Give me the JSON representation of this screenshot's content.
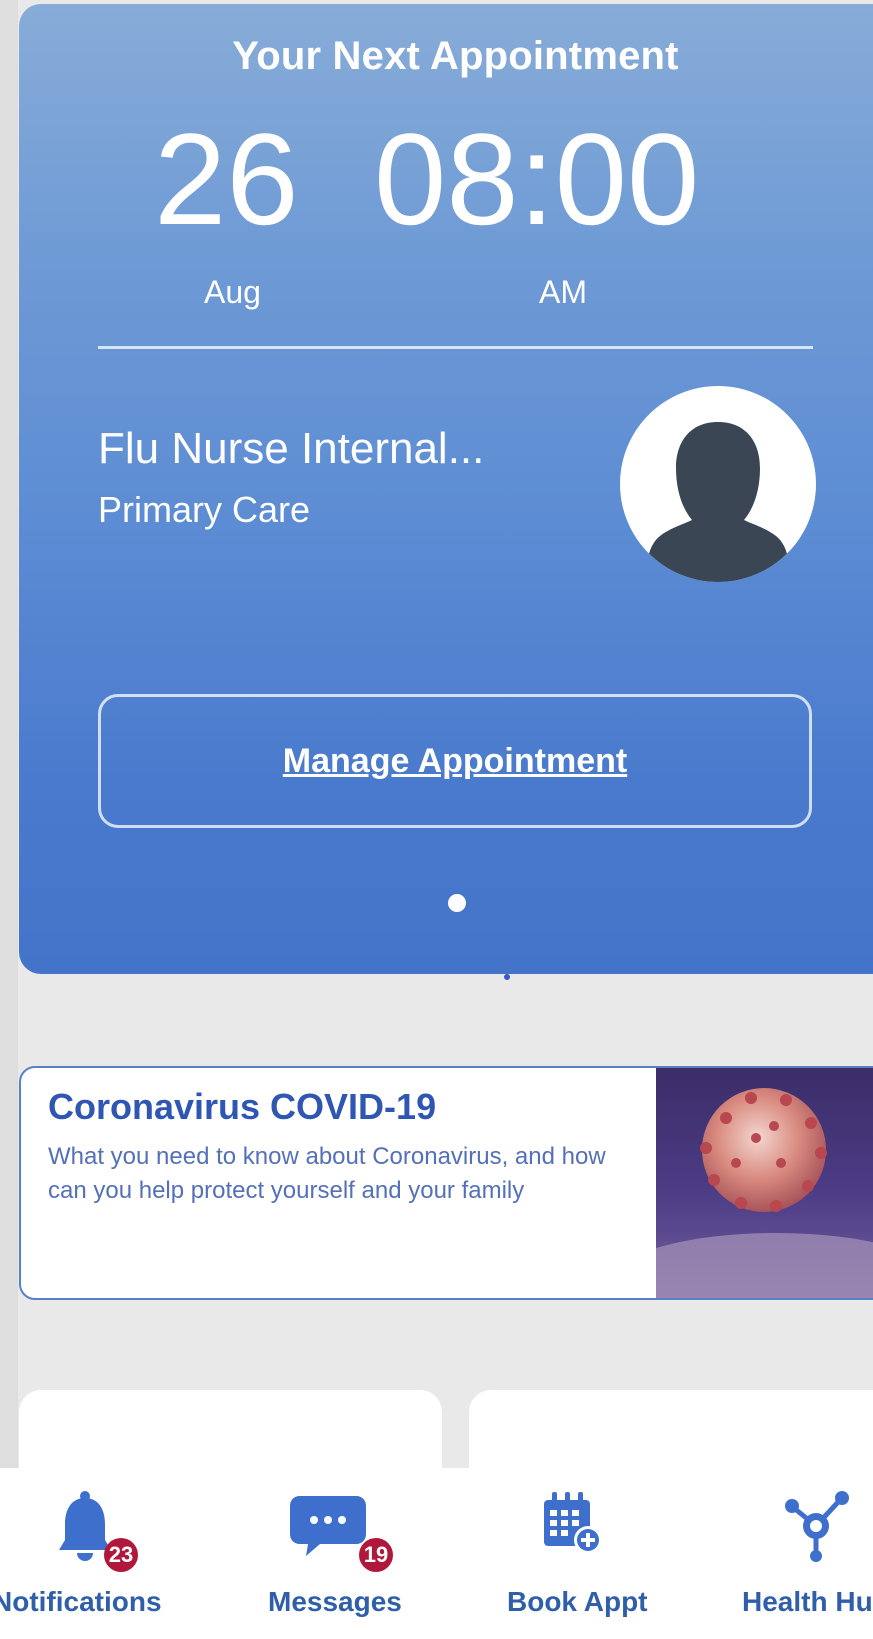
{
  "appointment": {
    "header": "Your Next Appointment",
    "day": "26",
    "month": "Aug",
    "time": "08:00",
    "ampm": "AM",
    "provider_name": "Flu Nurse Internal...",
    "department": "Primary Care",
    "manage_label": "Manage Appointment",
    "carousel_pages": 1,
    "carousel_current": 1
  },
  "news_card": {
    "title": "Coronavirus COVID-19",
    "description": "What you need to know about Coronavirus, and how can you help protect yourself and your family"
  },
  "bottom_nav": {
    "items": [
      {
        "label": "Notifications",
        "icon": "bell-icon",
        "badge": "23"
      },
      {
        "label": "Messages",
        "icon": "chat-bubble-icon",
        "badge": "19"
      },
      {
        "label": "Book Appt",
        "icon": "calendar-add-icon"
      },
      {
        "label": "Health Hub",
        "icon": "health-hub-network-icon"
      }
    ]
  },
  "colors": {
    "accent_blue": "#2f5fa8",
    "card_gradient_top": "#88acd8",
    "card_gradient_bottom": "#4474c9",
    "badge": "#b1173a",
    "news_title": "#2f56b3"
  }
}
